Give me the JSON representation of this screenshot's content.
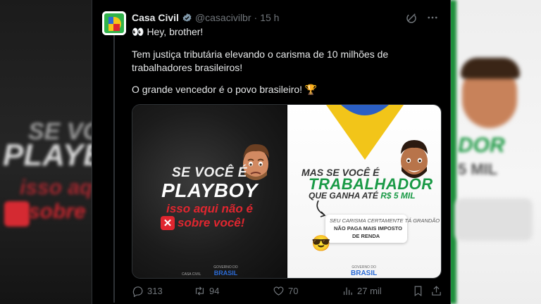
{
  "tweet": {
    "author_name": "Casa Civil",
    "handle": "@casacivilbr",
    "separator": "·",
    "time": "15 h",
    "line1_emoji": "👀",
    "line1": "Hey, brother!",
    "paragraph2": "Tem justiça tributária elevando o carisma de 10 milhões de trabalhadores brasileiros!",
    "paragraph3": "O grande vencedor é o povo brasileiro! 🏆"
  },
  "image_left": {
    "line1": "SE VOCÊ É",
    "line2": "PLAYBOY",
    "line3": "isso aqui não é",
    "line4": "sobre você!",
    "x_glyph": "✕",
    "footer_org": "CASA CIVIL",
    "footer_gov": "GOVERNO DO",
    "footer_brasil": "BRASIL"
  },
  "image_right": {
    "line1": "MAS SE VOCÊ É",
    "line2": "TRABALHADOR",
    "line3a": "QUE GANHA ATÉ ",
    "line3b": "R$ 5 MIL",
    "box_line1": "SEU CARISMA CERTAMENTE TÁ GRANDÃO PORQUE VOCÊ",
    "box_line2": "NÃO PAGA MAIS IMPOSTO",
    "box_line3": "DE RENDA",
    "emoji": "😎",
    "footer_gov": "GOVERNO DO",
    "footer_brasil": "BRASIL"
  },
  "actions": {
    "replies": "313",
    "retweets": "94",
    "likes": "70",
    "views": "27 mil"
  },
  "background": {
    "left_line1": "SE VO",
    "left_line2": "PLAYBO",
    "left_line3": "isso aqu",
    "left_line4": "sobre",
    "right_line1": "DOR",
    "right_line2": "5 MIL"
  },
  "colors": {
    "accent_green": "#1a9a46",
    "accent_red": "#e0262f",
    "brasil_blue": "#2b6bd6",
    "verified_blue": "#1d9bf0"
  }
}
